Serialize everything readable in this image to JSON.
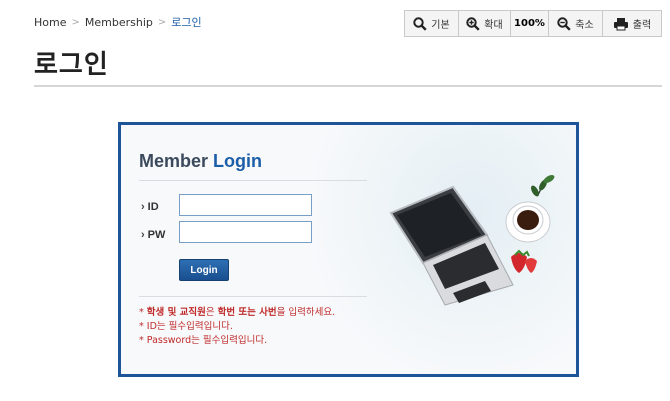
{
  "breadcrumb": {
    "home": "Home",
    "section": "Membership",
    "current": "로그인"
  },
  "toolbar": {
    "reset_label": "기본",
    "zoom_in_label": "확대",
    "zoom_level": "100%",
    "zoom_out_label": "축소",
    "print_label": "출력"
  },
  "page": {
    "title": "로그인"
  },
  "login": {
    "title_part1": "Member",
    "title_part2": "Login",
    "id_label": "ID",
    "pw_label": "PW",
    "id_value": "",
    "pw_value": "",
    "button_label": "Login"
  },
  "notes": {
    "line1_prefix": "* ",
    "line1_bold1": "학생 및 교직원",
    "line1_mid": "은 ",
    "line1_bold2": "학번 또는 사번",
    "line1_suffix": "을 입력하세요.",
    "line2": "* ID는 필수입력입니다.",
    "line3": "* Password는 필수입력입니다."
  },
  "colors": {
    "accent": "#1d5ea8",
    "frame": "#1e5598",
    "notice": "#c02a2a"
  },
  "icons": [
    "search-minus-icon",
    "zoom-in-icon",
    "zoom-out-icon",
    "printer-icon",
    "laptop-illustration",
    "coffee-cup-illustration",
    "strawberry-illustration"
  ]
}
